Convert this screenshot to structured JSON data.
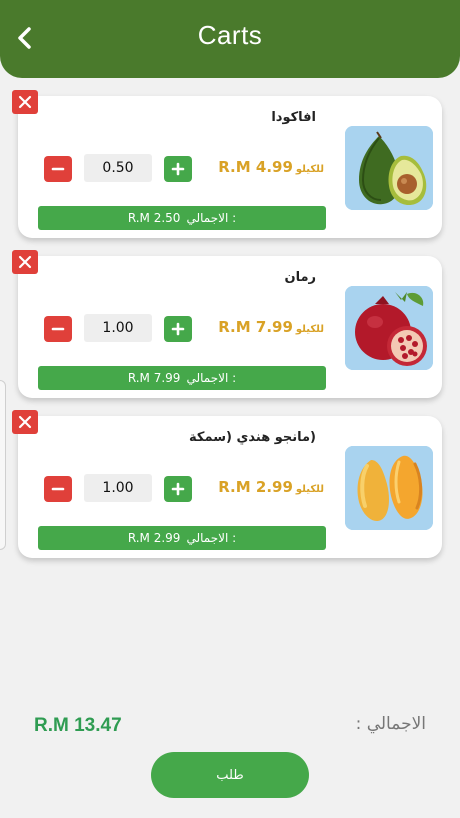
{
  "header": {
    "title": "Carts"
  },
  "items": [
    {
      "name": "افاكودا",
      "price": "R.M 4.99",
      "unit": "للكيلو",
      "qty": "0.50",
      "total_label": "الاجمالي :",
      "total_value": "R.M 2.50",
      "image": "avocado"
    },
    {
      "name": "رمان",
      "price": "R.M 7.99",
      "unit": "للكيلو",
      "qty": "1.00",
      "total_label": "الاجمالي :",
      "total_value": "R.M 7.99",
      "image": "pomegranate"
    },
    {
      "name": "(مانجو هندي (سمكة",
      "price": "R.M 2.99",
      "unit": "للكيلو",
      "qty": "1.00",
      "total_label": "الاجمالي :",
      "total_value": "R.M 2.99",
      "image": "mango"
    }
  ],
  "summary": {
    "label": "الاجمالي :",
    "value": "R.M 13.47"
  },
  "order_button": {
    "label": "طلب"
  },
  "colors": {
    "header": "#4a7a2c",
    "accent_green": "#45a84a",
    "remove_red": "#e0403a",
    "price_gold": "#d9a226",
    "total_text": "#2f9c52"
  }
}
